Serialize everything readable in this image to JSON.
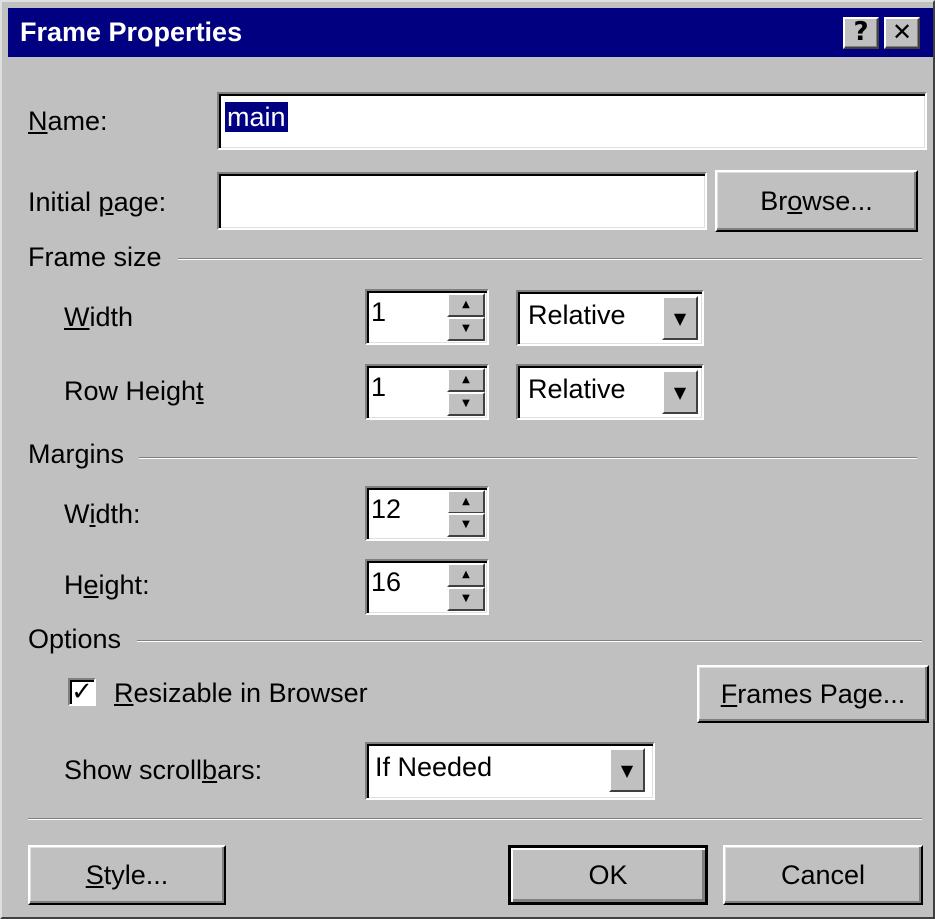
{
  "window": {
    "title": "Frame Properties",
    "help_glyph": "?",
    "close_glyph": "✕"
  },
  "name": {
    "label": "Name:",
    "value": "main"
  },
  "initial_page": {
    "label": "Initial page:",
    "value": "",
    "browse_label": "Browse..."
  },
  "frame_size": {
    "group_label": "Frame size",
    "width_label": "Width",
    "width_value": "1",
    "width_unit": "Relative",
    "row_height_label": "Row Height",
    "row_height_value": "1",
    "row_height_unit": "Relative"
  },
  "margins": {
    "group_label": "Margins",
    "width_label": "Width:",
    "width_value": "12",
    "height_label": "Height:",
    "height_value": "16"
  },
  "options": {
    "group_label": "Options",
    "resizable_label": "Resizable in Browser",
    "resizable_checked": true,
    "check_glyph": "✓",
    "frames_page_label": "Frames Page...",
    "scrollbars_label": "Show scrollbars:",
    "scrollbars_value": "If Needed"
  },
  "buttons": {
    "style_label": "Style...",
    "ok_label": "OK",
    "cancel_label": "Cancel"
  },
  "icons": {
    "spin_up": "▲",
    "spin_down": "▼",
    "dropdown": "▼"
  },
  "colors": {
    "face": "#c0c0c0",
    "titlebar": "#000080",
    "selection": "#000080"
  }
}
